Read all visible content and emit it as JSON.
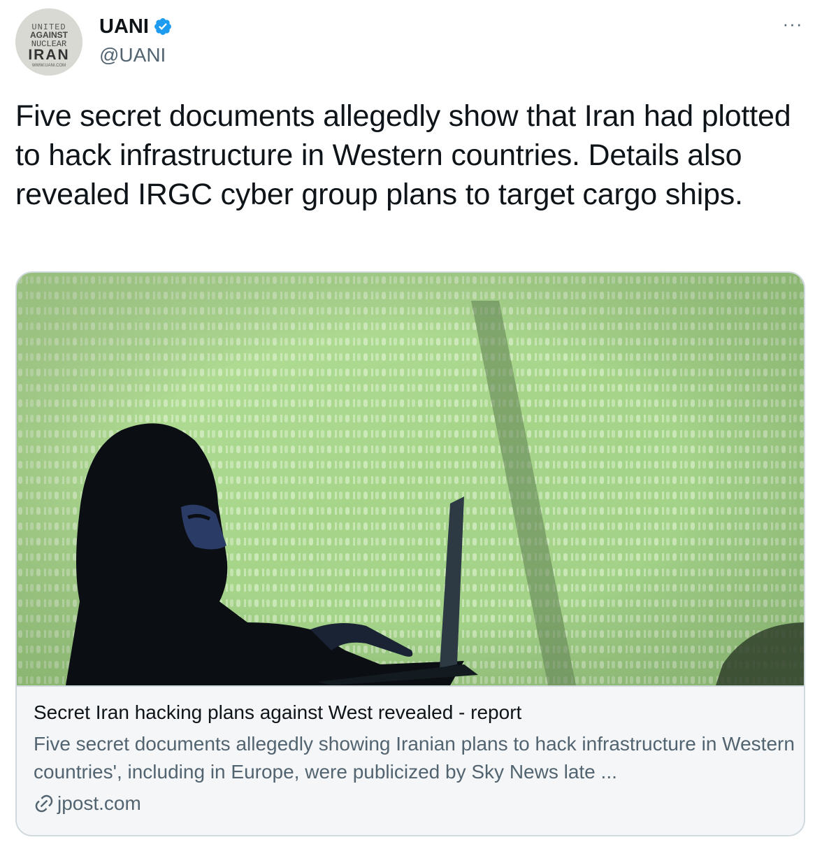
{
  "author": {
    "display_name": "UANI",
    "handle": "@UANI",
    "avatar_text": [
      "UNITED",
      "AGAINST",
      "NUCLEAR",
      "IRAN",
      "WWW.UANI.COM"
    ],
    "verified_icon": "verified-badge-icon",
    "verified_color": "#1d9bf0"
  },
  "more_label": "···",
  "tweet": {
    "text": "Five secret documents allegedly show that Iran had plotted to hack infrastructure in Western countries. Details also revealed IRGC cyber group plans to target cargo ships."
  },
  "card": {
    "image_icon": "hacker-silhouette-binary-photo",
    "title": "Secret Iran hacking plans against West revealed - report",
    "description": "Five secret documents allegedly showing Iranian plans to hack infrastructure in Western countries', including in Europe, were publicized by Sky News late ...",
    "domain": "jpost.com",
    "domain_icon": "link-icon"
  },
  "colors": {
    "text": "#0f1419",
    "secondary": "#536471",
    "border": "#cfd9de",
    "card_bg": "#f5f6f7",
    "image_green": "#a9d88a"
  }
}
